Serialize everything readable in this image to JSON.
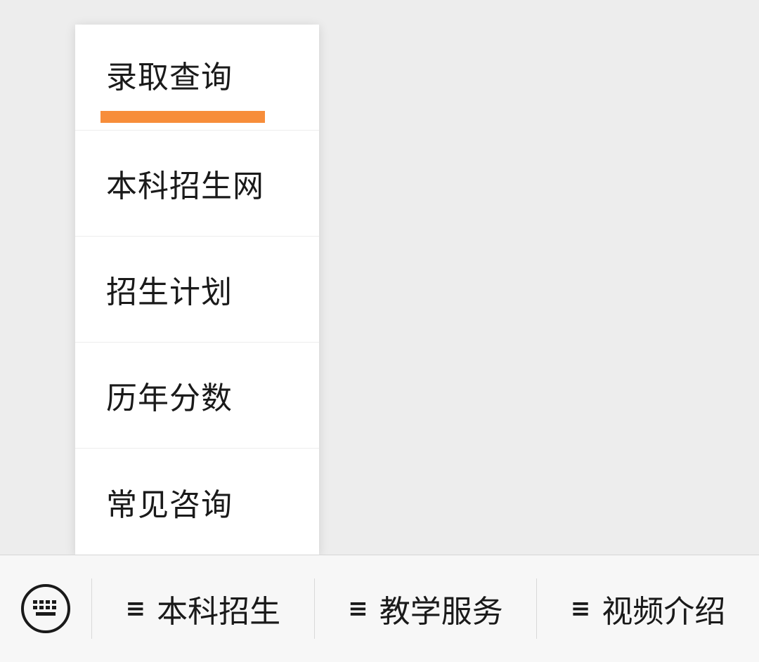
{
  "popup_menu": {
    "items": [
      {
        "label": "录取查询"
      },
      {
        "label": "本科招生网"
      },
      {
        "label": "招生计划"
      },
      {
        "label": "历年分数"
      },
      {
        "label": "常见咨询"
      }
    ],
    "active_index": 0,
    "accent_color": "#f78d3a"
  },
  "bottom_bar": {
    "keyboard_icon": "keyboard-icon",
    "tabs": [
      {
        "icon": "≡",
        "label": "本科招生"
      },
      {
        "icon": "≡",
        "label": "教学服务"
      },
      {
        "icon": "≡",
        "label": "视频介绍"
      }
    ]
  }
}
